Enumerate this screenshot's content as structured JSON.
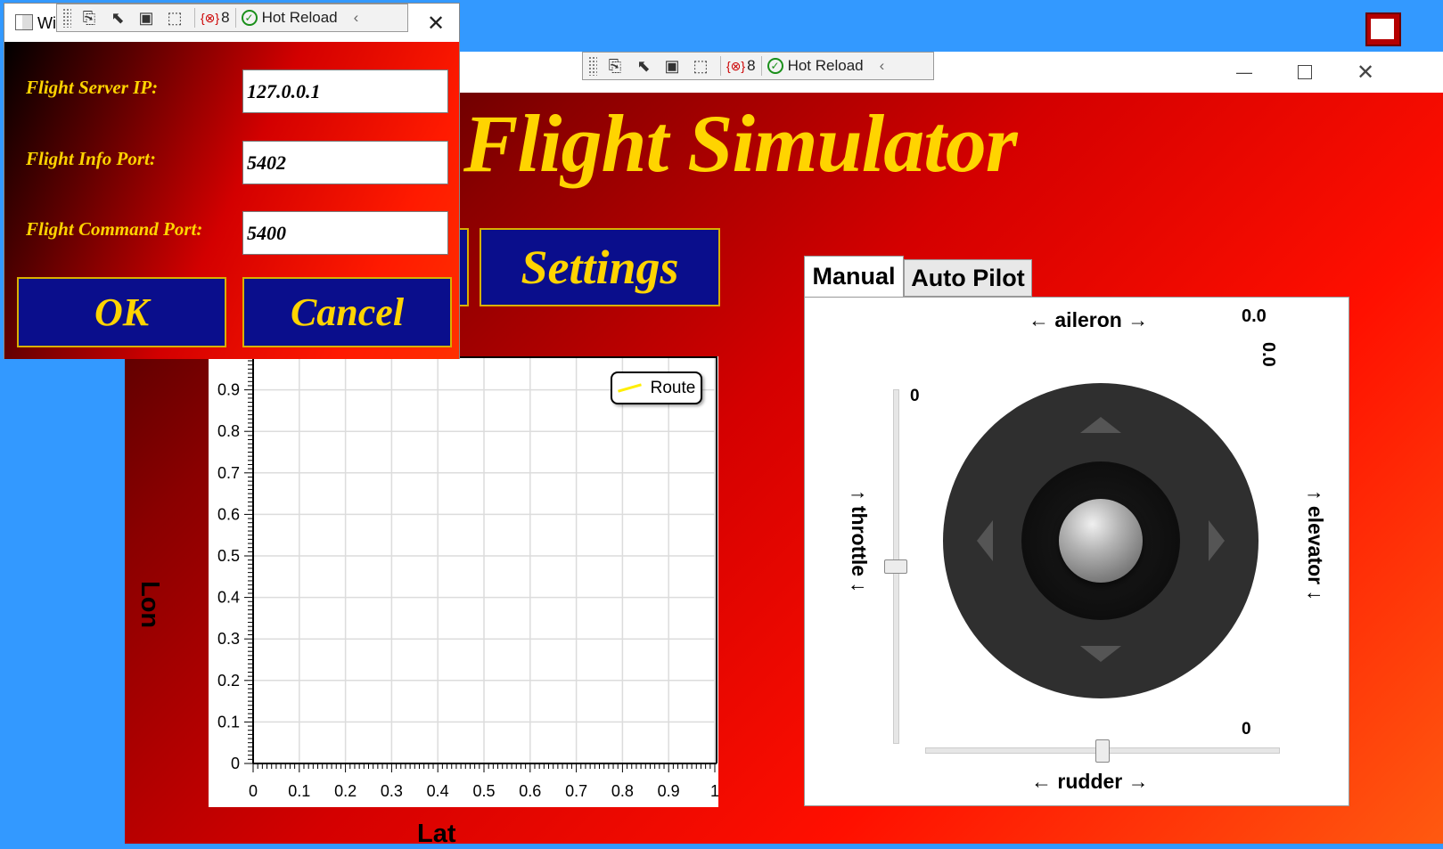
{
  "main_window": {
    "title": "Flight Simulator",
    "buttons": {
      "settings": "Settings"
    },
    "chart": {
      "legend": "Route",
      "x_ticks": [
        "0",
        "0.1",
        "0.2",
        "0.3",
        "0.4",
        "0.5",
        "0.6",
        "0.7",
        "0.8",
        "0.9",
        "1"
      ],
      "y_ticks": [
        "0",
        "0.1",
        "0.2",
        "0.3",
        "0.4",
        "0.5",
        "0.6",
        "0.7",
        "0.8",
        "0.9"
      ]
    },
    "tabs": [
      {
        "label": "Manual",
        "selected": true
      },
      {
        "label": "Auto Pilot",
        "selected": false
      }
    ],
    "manual": {
      "aileron_label": "← aileron →",
      "aileron_value": "0.0",
      "elevator_value": "0.0",
      "throttle_label": "↑ throttle ↓",
      "throttle_value": "0",
      "throttle_level": 0.5,
      "elevator_label": "↑ elevator ↓",
      "rudder_label": "← rudder →",
      "rudder_value": "0",
      "rudder_level": 0.5
    }
  },
  "chart_data": {
    "type": "line",
    "legend": [
      "Route"
    ],
    "series": [
      {
        "name": "Route",
        "color": "#ffff00",
        "x": [],
        "y": []
      }
    ],
    "xlabel": "Lat",
    "ylabel": "Lon",
    "xlim": [
      0,
      1
    ],
    "ylim": [
      0,
      1
    ],
    "x_ticks": [
      0,
      0.1,
      0.2,
      0.3,
      0.4,
      0.5,
      0.6,
      0.7,
      0.8,
      0.9,
      1
    ],
    "y_ticks": [
      0,
      0.1,
      0.2,
      0.3,
      0.4,
      0.5,
      0.6,
      0.7,
      0.8,
      0.9
    ],
    "grid": true,
    "legend_position": "top-right"
  },
  "dev_toolbar": {
    "error_count": "8",
    "hot_reload": "Hot Reload"
  },
  "dialog": {
    "title_fragment": "Wi",
    "fields": [
      {
        "label": "Flight Server IP:",
        "value": "127.0.0.1"
      },
      {
        "label": "Flight Info Port:",
        "value": "5402"
      },
      {
        "label": "Flight Command Port:",
        "value": "5400"
      }
    ],
    "ok": "OK",
    "cancel": "Cancel"
  },
  "colors": {
    "gold": "#ffd400",
    "button_blue": "#0a0e8c",
    "background_red": "#ff0f00",
    "desktop_blue": "#3399ff"
  }
}
